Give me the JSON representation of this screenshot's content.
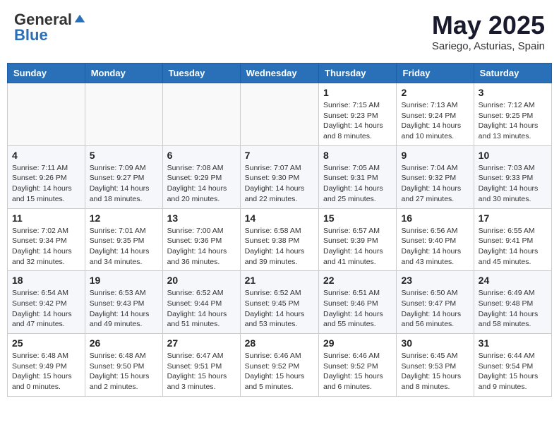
{
  "header": {
    "logo_general": "General",
    "logo_blue": "Blue",
    "month": "May 2025",
    "location": "Sariego, Asturias, Spain"
  },
  "weekdays": [
    "Sunday",
    "Monday",
    "Tuesday",
    "Wednesday",
    "Thursday",
    "Friday",
    "Saturday"
  ],
  "weeks": [
    [
      {
        "day": "",
        "info": ""
      },
      {
        "day": "",
        "info": ""
      },
      {
        "day": "",
        "info": ""
      },
      {
        "day": "",
        "info": ""
      },
      {
        "day": "1",
        "info": "Sunrise: 7:15 AM\nSunset: 9:23 PM\nDaylight: 14 hours\nand 8 minutes."
      },
      {
        "day": "2",
        "info": "Sunrise: 7:13 AM\nSunset: 9:24 PM\nDaylight: 14 hours\nand 10 minutes."
      },
      {
        "day": "3",
        "info": "Sunrise: 7:12 AM\nSunset: 9:25 PM\nDaylight: 14 hours\nand 13 minutes."
      }
    ],
    [
      {
        "day": "4",
        "info": "Sunrise: 7:11 AM\nSunset: 9:26 PM\nDaylight: 14 hours\nand 15 minutes."
      },
      {
        "day": "5",
        "info": "Sunrise: 7:09 AM\nSunset: 9:27 PM\nDaylight: 14 hours\nand 18 minutes."
      },
      {
        "day": "6",
        "info": "Sunrise: 7:08 AM\nSunset: 9:29 PM\nDaylight: 14 hours\nand 20 minutes."
      },
      {
        "day": "7",
        "info": "Sunrise: 7:07 AM\nSunset: 9:30 PM\nDaylight: 14 hours\nand 22 minutes."
      },
      {
        "day": "8",
        "info": "Sunrise: 7:05 AM\nSunset: 9:31 PM\nDaylight: 14 hours\nand 25 minutes."
      },
      {
        "day": "9",
        "info": "Sunrise: 7:04 AM\nSunset: 9:32 PM\nDaylight: 14 hours\nand 27 minutes."
      },
      {
        "day": "10",
        "info": "Sunrise: 7:03 AM\nSunset: 9:33 PM\nDaylight: 14 hours\nand 30 minutes."
      }
    ],
    [
      {
        "day": "11",
        "info": "Sunrise: 7:02 AM\nSunset: 9:34 PM\nDaylight: 14 hours\nand 32 minutes."
      },
      {
        "day": "12",
        "info": "Sunrise: 7:01 AM\nSunset: 9:35 PM\nDaylight: 14 hours\nand 34 minutes."
      },
      {
        "day": "13",
        "info": "Sunrise: 7:00 AM\nSunset: 9:36 PM\nDaylight: 14 hours\nand 36 minutes."
      },
      {
        "day": "14",
        "info": "Sunrise: 6:58 AM\nSunset: 9:38 PM\nDaylight: 14 hours\nand 39 minutes."
      },
      {
        "day": "15",
        "info": "Sunrise: 6:57 AM\nSunset: 9:39 PM\nDaylight: 14 hours\nand 41 minutes."
      },
      {
        "day": "16",
        "info": "Sunrise: 6:56 AM\nSunset: 9:40 PM\nDaylight: 14 hours\nand 43 minutes."
      },
      {
        "day": "17",
        "info": "Sunrise: 6:55 AM\nSunset: 9:41 PM\nDaylight: 14 hours\nand 45 minutes."
      }
    ],
    [
      {
        "day": "18",
        "info": "Sunrise: 6:54 AM\nSunset: 9:42 PM\nDaylight: 14 hours\nand 47 minutes."
      },
      {
        "day": "19",
        "info": "Sunrise: 6:53 AM\nSunset: 9:43 PM\nDaylight: 14 hours\nand 49 minutes."
      },
      {
        "day": "20",
        "info": "Sunrise: 6:52 AM\nSunset: 9:44 PM\nDaylight: 14 hours\nand 51 minutes."
      },
      {
        "day": "21",
        "info": "Sunrise: 6:52 AM\nSunset: 9:45 PM\nDaylight: 14 hours\nand 53 minutes."
      },
      {
        "day": "22",
        "info": "Sunrise: 6:51 AM\nSunset: 9:46 PM\nDaylight: 14 hours\nand 55 minutes."
      },
      {
        "day": "23",
        "info": "Sunrise: 6:50 AM\nSunset: 9:47 PM\nDaylight: 14 hours\nand 56 minutes."
      },
      {
        "day": "24",
        "info": "Sunrise: 6:49 AM\nSunset: 9:48 PM\nDaylight: 14 hours\nand 58 minutes."
      }
    ],
    [
      {
        "day": "25",
        "info": "Sunrise: 6:48 AM\nSunset: 9:49 PM\nDaylight: 15 hours\nand 0 minutes."
      },
      {
        "day": "26",
        "info": "Sunrise: 6:48 AM\nSunset: 9:50 PM\nDaylight: 15 hours\nand 2 minutes."
      },
      {
        "day": "27",
        "info": "Sunrise: 6:47 AM\nSunset: 9:51 PM\nDaylight: 15 hours\nand 3 minutes."
      },
      {
        "day": "28",
        "info": "Sunrise: 6:46 AM\nSunset: 9:52 PM\nDaylight: 15 hours\nand 5 minutes."
      },
      {
        "day": "29",
        "info": "Sunrise: 6:46 AM\nSunset: 9:52 PM\nDaylight: 15 hours\nand 6 minutes."
      },
      {
        "day": "30",
        "info": "Sunrise: 6:45 AM\nSunset: 9:53 PM\nDaylight: 15 hours\nand 8 minutes."
      },
      {
        "day": "31",
        "info": "Sunrise: 6:44 AM\nSunset: 9:54 PM\nDaylight: 15 hours\nand 9 minutes."
      }
    ]
  ]
}
